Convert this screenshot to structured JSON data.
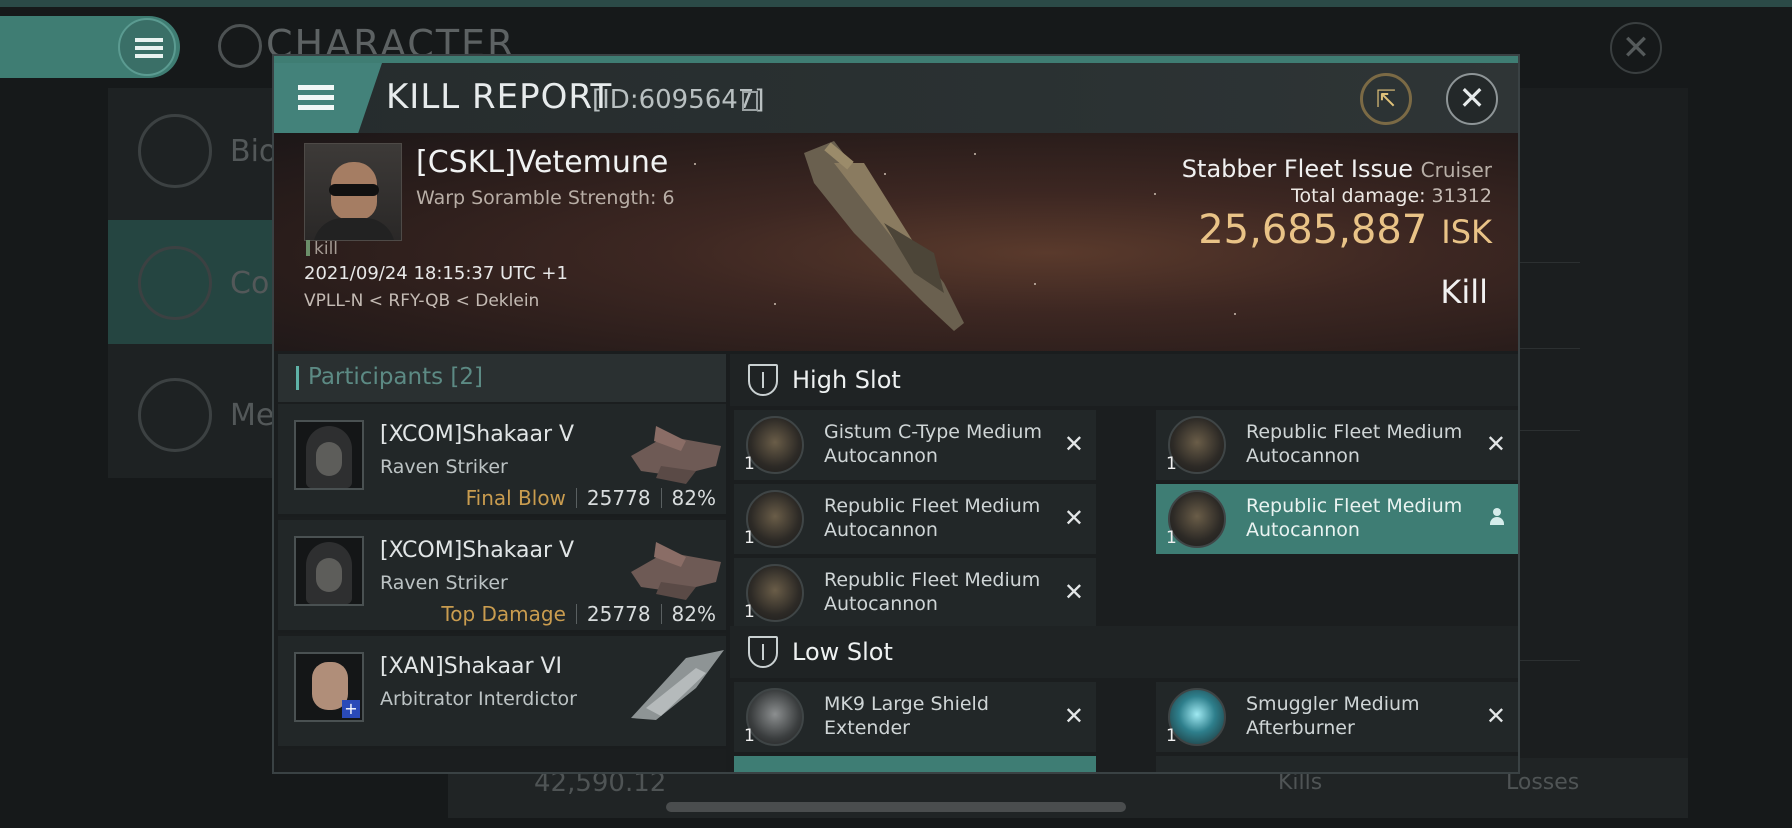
{
  "background": {
    "title": "CHARACTER",
    "left_items": [
      {
        "label": "Bio"
      },
      {
        "label": "Co"
      },
      {
        "label": "Me"
      }
    ],
    "bottom": {
      "amount": "42,590.12",
      "kills": "Kills",
      "losses": "Losses"
    }
  },
  "modal": {
    "title": "KILL REPORT",
    "report_id": "[ID:6095647]",
    "victim": {
      "name": "[CSKL]Vetemune",
      "warp_scramble": "Warp Soramble Strength: 6",
      "kill_tag": "kill",
      "datetime": "2021/09/24 18:15:37 UTC +1",
      "location": "VPLL-N < RFY-QB < Deklein"
    },
    "ship": {
      "name": "Stabber Fleet Issue",
      "class": "Cruiser",
      "total_damage_label": "Total damage:",
      "total_damage": "31312",
      "isk_value": "25,685,887",
      "isk_unit": "ISK",
      "result": "Kill"
    },
    "participants": {
      "header": "Participants",
      "count": "[2]",
      "rows": [
        {
          "name": "[XCOM]Shakaar V",
          "ship": "Raven Striker",
          "tag": "Final Blow",
          "damage": "25778",
          "percent": "82%"
        },
        {
          "name": "[XCOM]Shakaar V",
          "ship": "Raven Striker",
          "tag": "Top Damage",
          "damage": "25778",
          "percent": "82%"
        },
        {
          "name": "[XAN]Shakaar VI",
          "ship": "Arbitrator Interdictor",
          "tag": "",
          "damage": "",
          "percent": ""
        }
      ]
    },
    "high_slot": {
      "label": "High Slot",
      "modules": [
        {
          "qty": "1",
          "name": "Gistum C-Type Medium Autocannon"
        },
        {
          "qty": "1",
          "name": "Republic Fleet Medium Autocannon"
        },
        {
          "qty": "1",
          "name": "Republic Fleet Medium Autocannon"
        },
        {
          "qty": "1",
          "name": "Republic Fleet Medium Autocannon"
        },
        {
          "qty": "1",
          "name": "Republic Fleet Medium Autocannon"
        }
      ]
    },
    "low_slot": {
      "label": "Low Slot",
      "modules": [
        {
          "qty": "1",
          "name": "MK9 Large Shield Extender"
        },
        {
          "qty": "1",
          "name": "Smuggler Medium Afterburner"
        }
      ]
    }
  },
  "icons": [
    "menu-icon",
    "copy-icon",
    "share-icon",
    "close-icon",
    "remove-icon",
    "pilot-icon",
    "slot-icon"
  ],
  "colors": {
    "accent": "#3f7d73",
    "isk": "#e9c387",
    "tag": "#c99c4f"
  }
}
